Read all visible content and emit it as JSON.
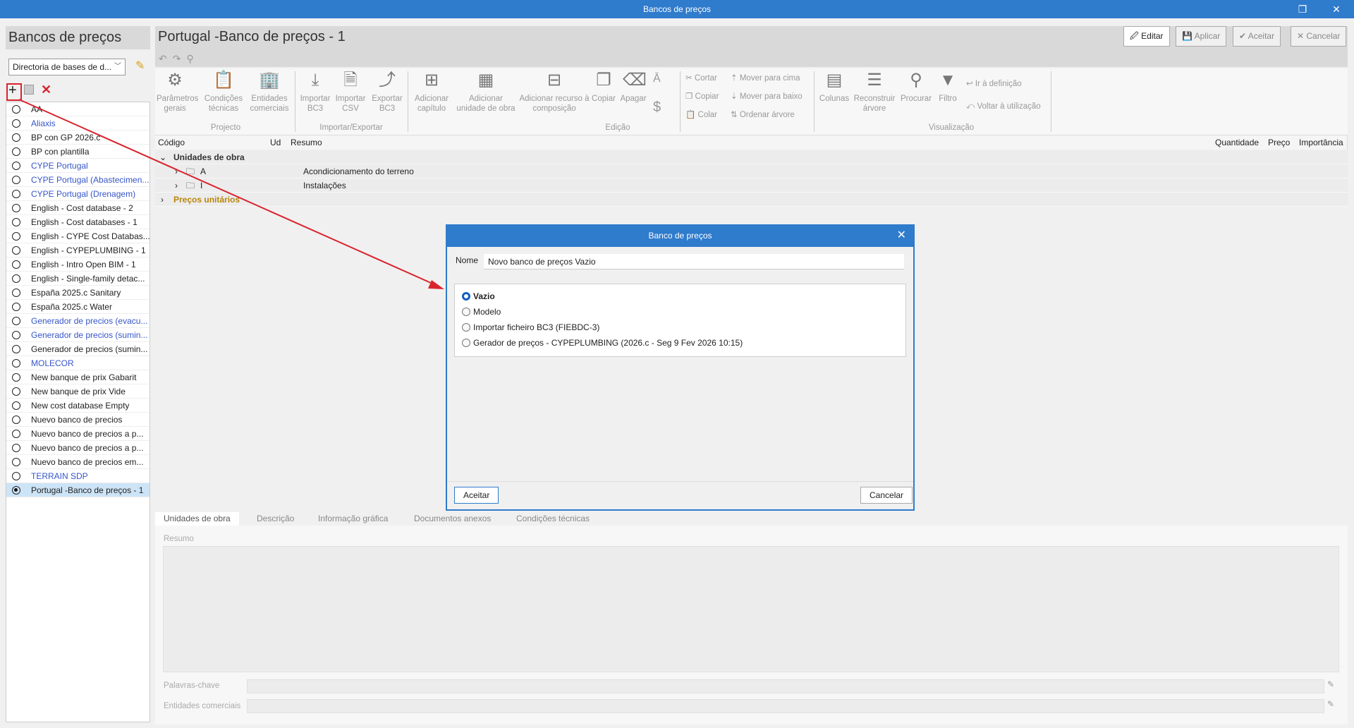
{
  "window": {
    "title": "Bancos de preços",
    "restore_icon": "restore-icon",
    "close_icon": "close-icon"
  },
  "sidebar": {
    "title": "Bancos de preços",
    "directory": "Directoria de bases de d...",
    "items": [
      {
        "label": "AA",
        "blue": false
      },
      {
        "label": "Aliaxis",
        "blue": true
      },
      {
        "label": "BP con GP 2026.c",
        "blue": false
      },
      {
        "label": "BP con plantilla",
        "blue": false
      },
      {
        "label": "CYPE Portugal",
        "blue": true
      },
      {
        "label": "CYPE Portugal (Abastecimen...",
        "blue": true
      },
      {
        "label": "CYPE Portugal (Drenagem)",
        "blue": true
      },
      {
        "label": "English - Cost database - 2",
        "blue": false
      },
      {
        "label": "English - Cost databases - 1",
        "blue": false
      },
      {
        "label": "English - CYPE Cost Databas...",
        "blue": false
      },
      {
        "label": "English - CYPEPLUMBING - 1",
        "blue": false
      },
      {
        "label": "English - Intro Open BIM - 1",
        "blue": false
      },
      {
        "label": "English - Single-family detac...",
        "blue": false
      },
      {
        "label": "España 2025.c Sanitary",
        "blue": false
      },
      {
        "label": "España 2025.c Water",
        "blue": false
      },
      {
        "label": "Generador de precios (evacu...",
        "blue": true
      },
      {
        "label": "Generador de precios (sumin...",
        "blue": true
      },
      {
        "label": "Generador de precios (sumin...",
        "blue": false
      },
      {
        "label": "MOLECOR",
        "blue": true
      },
      {
        "label": "New banque de prix Gabarit",
        "blue": false
      },
      {
        "label": "New banque de prix Vide",
        "blue": false
      },
      {
        "label": "New cost database Empty",
        "blue": false
      },
      {
        "label": "Nuevo banco de precios",
        "blue": false
      },
      {
        "label": "Nuevo banco de precios a p...",
        "blue": false
      },
      {
        "label": "Nuevo banco de precios a p...",
        "blue": false
      },
      {
        "label": "Nuevo banco de precios em...",
        "blue": false
      },
      {
        "label": "TERRAIN SDP",
        "blue": true
      },
      {
        "label": "Portugal -Banco de preços - 1",
        "blue": false,
        "selected": true
      }
    ]
  },
  "main": {
    "title": "Portugal -Banco de preços - 1",
    "buttons": {
      "edit": "Editar",
      "apply": "Aplicar",
      "accept": "Aceitar",
      "cancel": "Cancelar"
    },
    "ribbon": {
      "projecto": {
        "label": "Projecto",
        "params": "Parâmetros gerais",
        "cond": "Condições técnicas",
        "ent": "Entidades comerciais"
      },
      "io": {
        "label": "Importar/Exportar",
        "imp_bc3": "Importar BC3",
        "imp_csv": "Importar CSV",
        "exp_bc3": "Exportar BC3"
      },
      "edicao": {
        "label": "Edição",
        "add_cap": "Adicionar capítulo",
        "add_uo": "Adicionar unidade de obra",
        "add_rec": "Adicionar recurso à composição",
        "copy": "Copiar",
        "delete": "Apagar",
        "cut": "Cortar",
        "copy2": "Copiar",
        "paste": "Colar",
        "up": "Mover para cima",
        "down": "Mover para baixo",
        "sort": "Ordenar árvore"
      },
      "vis": {
        "label": "Visualização",
        "cols": "Colunas",
        "rebuild": "Reconstruir árvore",
        "search": "Procurar",
        "filter": "Filtro",
        "goto": "Ir à definição",
        "back": "Voltar à utilização"
      }
    },
    "grid": {
      "columns": [
        "Código",
        "Ud",
        "Resumo",
        "Quantidade",
        "Preço",
        "Importância"
      ],
      "rows": [
        {
          "code": "Unidades de obra",
          "summary": ""
        },
        {
          "code": "A",
          "summary": "Acondicionamento do terreno"
        },
        {
          "code": "I",
          "summary": "Instalações"
        },
        {
          "code": "Preços unitários",
          "summary": ""
        }
      ]
    },
    "tabs": [
      "Unidades de obra",
      "Descrição",
      "Informação gráfica",
      "Documentos anexos",
      "Condições técnicas"
    ],
    "resumo_label": "Resumo",
    "keywords_label": "Palavras-chave",
    "entities_label": "Entidades comerciais"
  },
  "dialog": {
    "title": "Banco de preços",
    "name_label": "Nome",
    "name_value": "Novo banco de preços Vazio",
    "options": [
      "Vazio",
      "Modelo",
      "Importar ficheiro BC3 (FIEBDC-3)",
      "Gerador de preços - CYPEPLUMBING (2026.c - Seg  9 Fev 2026  10:15)"
    ],
    "selected": "Vazio",
    "ok": "Aceitar",
    "cancel": "Cancelar"
  },
  "annotation": {
    "color": "#d9232e"
  },
  "colors": {
    "titlebar": "#2f7bcc",
    "link_blue": "#3656c8",
    "gold": "#b8860b",
    "selection": "#cde4f7"
  }
}
